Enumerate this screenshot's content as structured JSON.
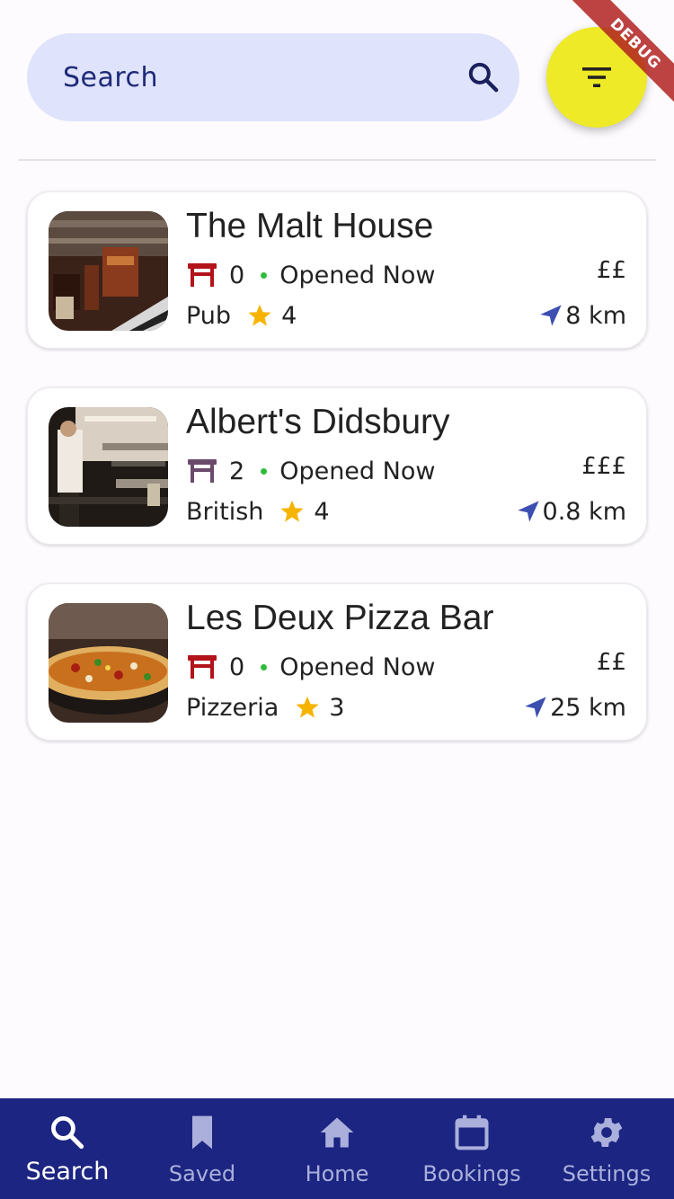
{
  "search": {
    "placeholder": "Search",
    "icon": "search-icon"
  },
  "filter_button": {
    "icon": "filter-icon",
    "color": "#eeea27"
  },
  "debug_banner": "DEBUG",
  "restaurants": [
    {
      "name": "The Malt House",
      "seats": "0",
      "seat_icon_color": "#b3131a",
      "status": "Opened Now",
      "price": "££",
      "category": "Pub",
      "rating": "4",
      "distance": "8 km"
    },
    {
      "name": "Albert's Didsbury",
      "seats": "2",
      "seat_icon_color": "#6b4a6c",
      "status": "Opened Now",
      "price": "£££",
      "category": "British",
      "rating": "4",
      "distance": "0.8 km"
    },
    {
      "name": "Les Deux Pizza Bar",
      "seats": "0",
      "seat_icon_color": "#b3131a",
      "status": "Opened Now",
      "price": "££",
      "category": "Pizzeria",
      "rating": "3",
      "distance": "25 km"
    }
  ],
  "colors": {
    "accent": "#1c2581",
    "star": "#f6b400",
    "open_dot": "#2fbc3a",
    "nav_arrow": "#3d4fb0"
  },
  "bottom_nav": {
    "items": [
      {
        "label": "Search",
        "icon": "search-icon",
        "active": true
      },
      {
        "label": "Saved",
        "icon": "bookmark-icon",
        "active": false
      },
      {
        "label": "Home",
        "icon": "home-icon",
        "active": false
      },
      {
        "label": "Bookings",
        "icon": "calendar-icon",
        "active": false
      },
      {
        "label": "Settings",
        "icon": "gear-icon",
        "active": false
      }
    ]
  }
}
